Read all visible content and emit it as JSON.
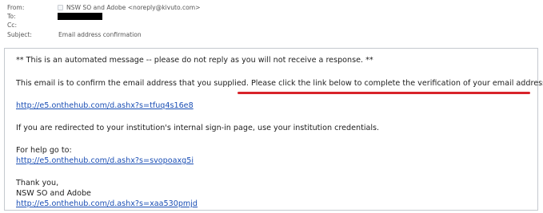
{
  "header": {
    "from_label": "From:",
    "from_value": "NSW SO and Adobe <noreply@kivuto.com>",
    "to_label": "To:",
    "cc_label": "Cc:",
    "subject_label": "Subject:",
    "subject_value": "Email address confirmation"
  },
  "body": {
    "automated_notice": "** This is an automated message -- please do not reply as you will not receive a response. **",
    "confirm_text": "This email is to confirm the email address that you supplied.",
    "click_instruction": " Please click the link below to complete the verification of your email address:",
    "verify_link": "http://e5.onthehub.com/d.ashx?s=tfuq4s16e8",
    "redirect_text": "If you are redirected to your institution's internal sign-in page, use your institution credentials.",
    "help_text": "For help go to:",
    "help_link": "http://e5.onthehub.com/d.ashx?s=svopoaxg5i",
    "thanks_text": "Thank you,",
    "signature": "NSW SO and Adobe",
    "signature_link": "http://e5.onthehub.com/d.ashx?s=xaa530pmjd"
  },
  "colors": {
    "link": "#1b4fb5",
    "highlight_underline": "#d8232a",
    "redaction": "#000000"
  }
}
